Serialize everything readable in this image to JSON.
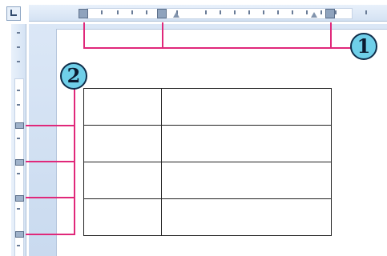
{
  "callouts": {
    "callout_1": {
      "label": "1",
      "color": "#e0287a",
      "badge_color": "#6fcfe9"
    },
    "callout_2": {
      "label": "2",
      "color": "#e0287a",
      "badge_color": "#6fcfe9"
    }
  },
  "colors": {
    "workspace": "#c9daef",
    "page": "#ffffff",
    "table_lines": "#222222",
    "ruler": "#d4e2f3"
  },
  "icons": {
    "tab_selector": "tab-stop-selector-icon",
    "column_markers": "table-column-marker-icon",
    "row_markers": "table-row-marker-icon"
  },
  "table": {
    "rows": 4,
    "columns": 2
  }
}
